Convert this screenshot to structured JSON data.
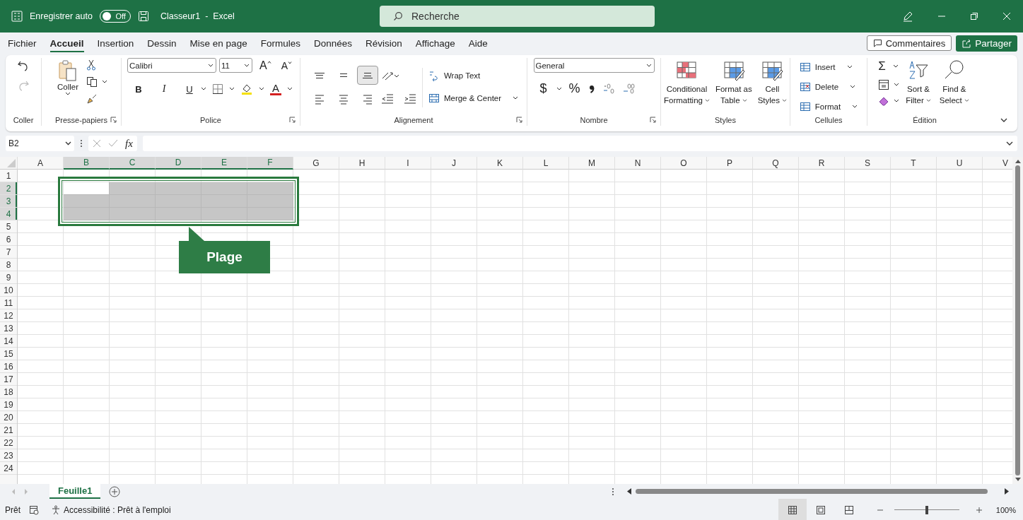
{
  "title_bar": {
    "autosave_label": "Enregistrer auto",
    "autosave": {
      "on": false,
      "label": "Off"
    },
    "title": "Classeur1  -  Excel",
    "search": {
      "placeholder": "Recherche"
    }
  },
  "menu_tabs": [
    {
      "label": "Fichier",
      "selected": false
    },
    {
      "label": "Accueil",
      "selected": true
    },
    {
      "label": "Insertion",
      "selected": false
    },
    {
      "label": "Dessin",
      "selected": false
    },
    {
      "label": "Mise en page",
      "selected": false
    },
    {
      "label": "Formules",
      "selected": false
    },
    {
      "label": "Données",
      "selected": false
    },
    {
      "label": "Révision",
      "selected": false
    },
    {
      "label": "Affichage",
      "selected": false
    },
    {
      "label": "Aide",
      "selected": false
    }
  ],
  "comments_button": "Commentaires",
  "share_button": "Partager",
  "ribbon": {
    "undo": {
      "label": "Coller"
    },
    "clipboard": {
      "paste": "Coller",
      "label": "Presse-papiers"
    },
    "font": {
      "font": "Calibri",
      "size": "11",
      "grow": "A",
      "shrink": "A",
      "styles": [
        "B",
        "I",
        "U"
      ],
      "color_letter": "A",
      "label": "Police"
    },
    "alignment": {
      "vertical_align": [
        {
          "selected": false
        },
        {
          "selected": false
        },
        {
          "selected": true
        }
      ],
      "horizontal_align": [
        {
          "selected": false
        },
        {
          "selected": false
        },
        {
          "selected": false
        }
      ],
      "wrap": "Wrap Text",
      "merge": "Merge & Center",
      "label": "Alignement"
    },
    "number": {
      "format": "General",
      "currency": "$",
      "percent": "%",
      "label": "Nombre"
    },
    "styles": {
      "items": [
        {
          "lines": [
            "Conditional",
            "Formatting"
          ]
        },
        {
          "lines": [
            "Format as",
            "Table"
          ]
        },
        {
          "lines": [
            "Cell",
            "Styles"
          ]
        }
      ],
      "label": "Styles"
    },
    "cells": {
      "items": [
        "Insert",
        "Delete",
        "Format"
      ],
      "label": "Cellules"
    },
    "editing": {
      "sum": "Σ",
      "sort": [
        "Sort &",
        "Filter"
      ],
      "find": [
        "Find &",
        "Select"
      ],
      "label": "Édition"
    }
  },
  "formula_bar": {
    "name_box": "B2",
    "function_label": "fx"
  },
  "grid": {
    "columns": [
      {
        "label": "A",
        "selected": false
      },
      {
        "label": "B",
        "selected": true
      },
      {
        "label": "C",
        "selected": true
      },
      {
        "label": "D",
        "selected": true
      },
      {
        "label": "E",
        "selected": true
      },
      {
        "label": "F",
        "selected": true
      },
      {
        "label": "G",
        "selected": false
      },
      {
        "label": "H",
        "selected": false
      },
      {
        "label": "I",
        "selected": false
      },
      {
        "label": "J",
        "selected": false
      },
      {
        "label": "K",
        "selected": false
      },
      {
        "label": "L",
        "selected": false
      },
      {
        "label": "M",
        "selected": false
      },
      {
        "label": "N",
        "selected": false
      },
      {
        "label": "O",
        "selected": false
      },
      {
        "label": "P",
        "selected": false
      },
      {
        "label": "Q",
        "selected": false
      },
      {
        "label": "R",
        "selected": false
      },
      {
        "label": "S",
        "selected": false
      },
      {
        "label": "T",
        "selected": false
      },
      {
        "label": "U",
        "selected": false
      },
      {
        "label": "V",
        "selected": false
      }
    ],
    "rows": [
      {
        "label": "1",
        "selected": false
      },
      {
        "label": "2",
        "selected": true
      },
      {
        "label": "3",
        "selected": true
      },
      {
        "label": "4",
        "selected": true
      },
      {
        "label": "5",
        "selected": false
      },
      {
        "label": "6",
        "selected": false
      },
      {
        "label": "7",
        "selected": false
      },
      {
        "label": "8",
        "selected": false
      },
      {
        "label": "9",
        "selected": false
      },
      {
        "label": "10",
        "selected": false
      },
      {
        "label": "11",
        "selected": false
      },
      {
        "label": "12",
        "selected": false
      },
      {
        "label": "13",
        "selected": false
      },
      {
        "label": "14",
        "selected": false
      },
      {
        "label": "15",
        "selected": false
      },
      {
        "label": "16",
        "selected": false
      },
      {
        "label": "17",
        "selected": false
      },
      {
        "label": "18",
        "selected": false
      },
      {
        "label": "19",
        "selected": false
      },
      {
        "label": "20",
        "selected": false
      },
      {
        "label": "21",
        "selected": false
      },
      {
        "label": "22",
        "selected": false
      },
      {
        "label": "23",
        "selected": false
      },
      {
        "label": "24",
        "selected": false
      }
    ],
    "callout": {
      "text": "Plage"
    }
  },
  "sheet_tabs": [
    {
      "label": "Feuille1",
      "selected": true
    }
  ],
  "status_bar": {
    "ready": "Prêt",
    "accessibility": "Accessibilité : Prêt à l'emploi",
    "views": [
      {
        "selected": true
      },
      {
        "selected": false
      },
      {
        "selected": false
      }
    ],
    "zoom": {
      "level": 0.5,
      "reading": "100%"
    }
  }
}
